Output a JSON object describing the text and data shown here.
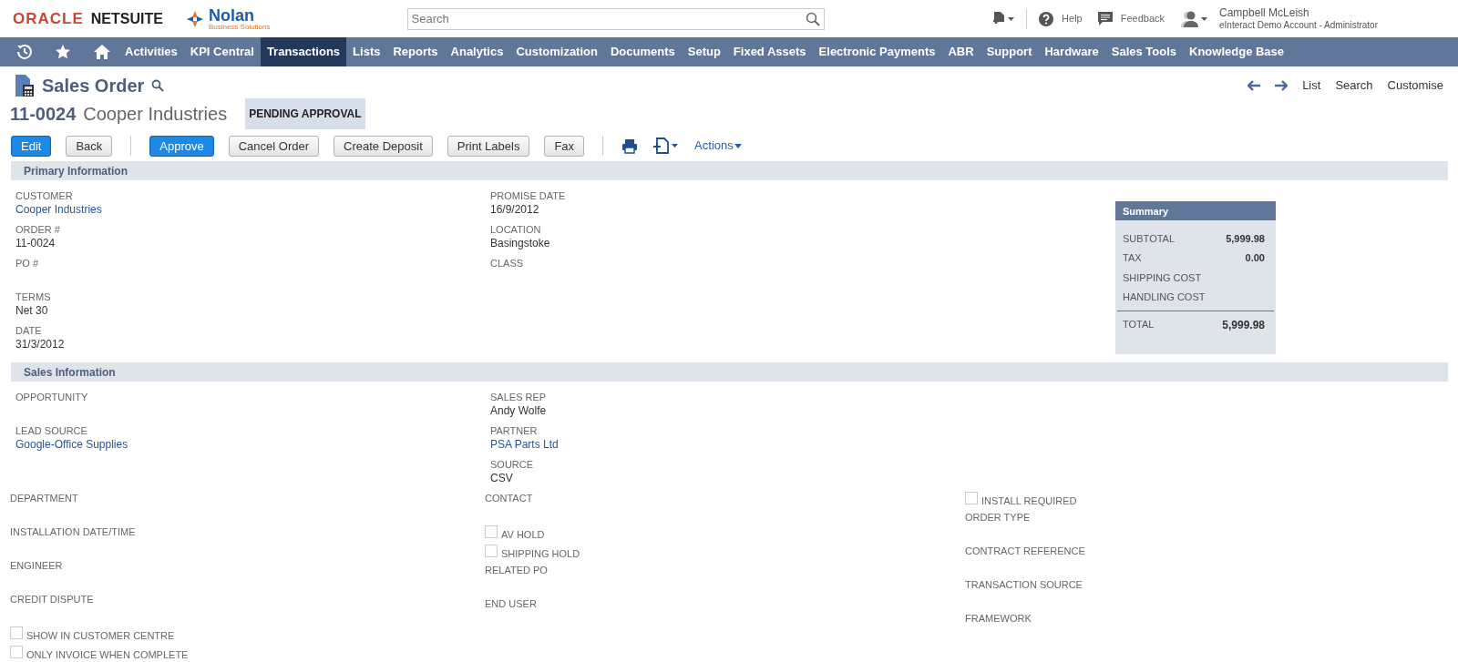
{
  "header": {
    "brand": "ORACLE",
    "product": "NETSUITE",
    "company": "Nolan",
    "company_tagline": "Business Solutions",
    "search": {
      "placeholder": "Search"
    },
    "help": "Help",
    "feedback": "Feedback",
    "user": {
      "name": "Campbell McLeish",
      "account": "eInteract Demo Account - Administrator"
    }
  },
  "nav": [
    {
      "label": "Activities",
      "selected": false
    },
    {
      "label": "KPI Central",
      "selected": false
    },
    {
      "label": "Transactions",
      "selected": true
    },
    {
      "label": "Lists",
      "selected": false
    },
    {
      "label": "Reports",
      "selected": false
    },
    {
      "label": "Analytics",
      "selected": false
    },
    {
      "label": "Customization",
      "selected": false
    },
    {
      "label": "Documents",
      "selected": false
    },
    {
      "label": "Setup",
      "selected": false
    },
    {
      "label": "Fixed Assets",
      "selected": false
    },
    {
      "label": "Electronic Payments",
      "selected": false
    },
    {
      "label": "ABR",
      "selected": false
    },
    {
      "label": "Support",
      "selected": false
    },
    {
      "label": "Hardware",
      "selected": false
    },
    {
      "label": "Sales Tools",
      "selected": false
    },
    {
      "label": "Knowledge Base",
      "selected": false
    }
  ],
  "page": {
    "title": "Sales Order",
    "record_number": "11-0024",
    "record_name": "Cooper Industries",
    "status": "PENDING APPROVAL",
    "links": [
      "List",
      "Search",
      "Customise"
    ]
  },
  "buttons": [
    {
      "label": "Edit",
      "primary": true
    },
    {
      "label": "Back",
      "primary": false
    },
    {
      "label": "Approve",
      "primary": true
    },
    {
      "label": "Cancel Order",
      "primary": false
    },
    {
      "label": "Create Deposit",
      "primary": false
    },
    {
      "label": "Print Labels",
      "primary": false
    },
    {
      "label": "Fax",
      "primary": false
    }
  ],
  "actions": "Actions",
  "sections": [
    {
      "title": "Primary Information",
      "columns": [
        [
          {
            "kind": "field",
            "label": "CUSTOMER",
            "value": "Cooper Industries",
            "link": true
          },
          {
            "kind": "field",
            "label": "ORDER #",
            "value": "11-0024",
            "link": false
          },
          {
            "kind": "field",
            "label": "PO #"
          },
          {
            "kind": "field",
            "label": "TERMS",
            "value": "Net 30",
            "link": false
          },
          {
            "kind": "field",
            "label": "DATE",
            "value": "31/3/2012",
            "link": false
          }
        ],
        [
          {
            "kind": "field",
            "label": "PROMISE DATE",
            "value": "16/9/2012",
            "link": false
          },
          {
            "kind": "field",
            "label": "LOCATION",
            "value": "Basingstoke",
            "link": false
          },
          {
            "kind": "field",
            "label": "CLASS"
          }
        ]
      ],
      "summary": {
        "title": "Summary",
        "rows": [
          {
            "label": "SUBTOTAL",
            "value": "5,999.98"
          },
          {
            "label": "TAX",
            "value": "0.00"
          },
          {
            "label": "SHIPPING COST"
          },
          {
            "label": "HANDLING COST"
          }
        ],
        "total": {
          "label": "TOTAL",
          "value": "5,999.98"
        }
      }
    },
    {
      "title": "Sales Information",
      "columns": [
        [
          {
            "kind": "field",
            "label": "OPPORTUNITY"
          },
          {
            "kind": "field",
            "label": "LEAD SOURCE",
            "value": "Google-Office Supplies",
            "link": true
          }
        ],
        [
          {
            "kind": "field",
            "label": "SALES REP",
            "value": "Andy Wolfe",
            "link": false
          },
          {
            "kind": "field",
            "label": "PARTNER",
            "value": "PSA Parts Ltd",
            "link": true
          },
          {
            "kind": "field",
            "label": "SOURCE",
            "value": "CSV",
            "link": false
          }
        ]
      ]
    }
  ],
  "extra_columns": [
    [
      {
        "kind": "field",
        "label": "DEPARTMENT"
      },
      {
        "kind": "field",
        "label": "INSTALLATION DATE/TIME"
      },
      {
        "kind": "field",
        "label": "ENGINEER"
      },
      {
        "kind": "field",
        "label": "CREDIT DISPUTE"
      },
      {
        "kind": "checkbox",
        "label": "SHOW IN CUSTOMER CENTRE",
        "checked": false
      },
      {
        "kind": "checkbox",
        "label": "ONLY INVOICE WHEN COMPLETE",
        "checked": false
      }
    ],
    [
      {
        "kind": "field",
        "label": "CONTACT"
      },
      {
        "kind": "checkbox",
        "label": "AV HOLD",
        "checked": false
      },
      {
        "kind": "checkbox",
        "label": "SHIPPING HOLD",
        "checked": false
      },
      {
        "kind": "field",
        "label": "RELATED PO"
      },
      {
        "kind": "field",
        "label": "END USER"
      }
    ],
    [
      {
        "kind": "checkbox",
        "label": "INSTALL REQUIRED",
        "checked": false
      },
      {
        "kind": "field",
        "label": "ORDER TYPE"
      },
      {
        "kind": "field",
        "label": "CONTRACT REFERENCE"
      },
      {
        "kind": "field",
        "label": "TRANSACTION SOURCE"
      },
      {
        "kind": "field",
        "label": "FRAMEWORK"
      }
    ]
  ]
}
